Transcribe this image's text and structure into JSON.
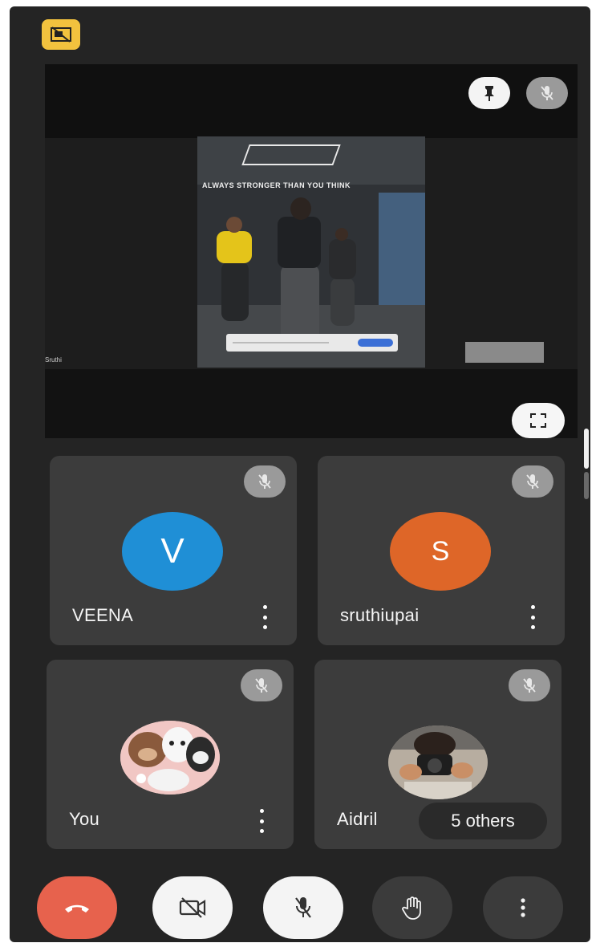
{
  "featured": {
    "presenter_tag": "Sruthi",
    "video_slogan": "ALWAYS STRONGER THAN YOU THINK"
  },
  "tiles": [
    {
      "name": "VEENA",
      "avatar_letter": "V",
      "avatar_color": "#1f8fd6",
      "muted": true
    },
    {
      "name": "sruthiupai",
      "avatar_letter": "S",
      "avatar_color": "#de6628",
      "muted": true
    },
    {
      "name": "You",
      "avatar_image": "bear-cartoon-avatar",
      "muted": true
    },
    {
      "name": "Aidril",
      "avatar_image": "camera-photo-avatar",
      "muted": true,
      "others_label": "5 others"
    }
  ],
  "controls": {
    "end_call_color": "#e7624d",
    "presenting_badge_color": "#f2c23e"
  },
  "icons": [
    "present-off-icon",
    "pin-icon",
    "mic-off-icon",
    "fullscreen-icon",
    "more-vert-icon",
    "end-call-icon",
    "camera-off-icon",
    "raise-hand-icon"
  ]
}
